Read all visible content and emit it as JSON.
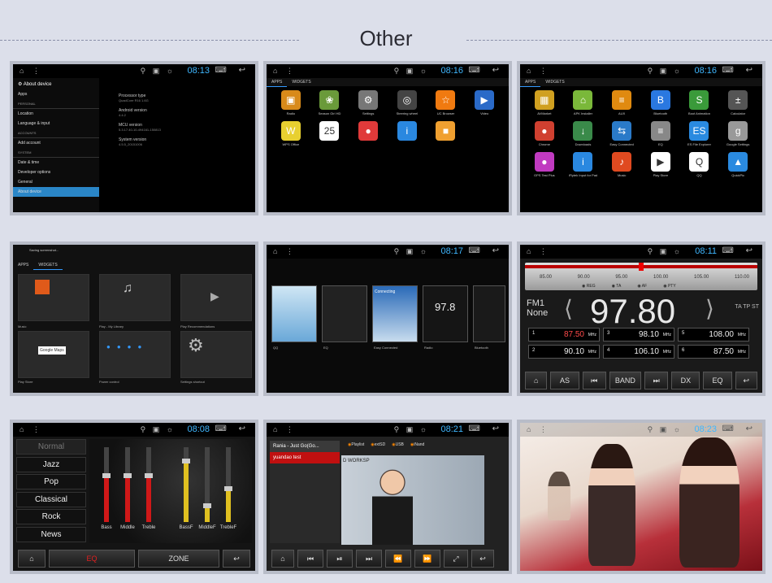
{
  "header": {
    "title": "Other"
  },
  "status": {
    "t1": "08:13",
    "t2": "08:16",
    "t3": "08:16",
    "t5": "08:17",
    "t6": "08:11",
    "t7": "08:08",
    "t8": "08:21",
    "t9": "08:23"
  },
  "settings": {
    "header": "About device",
    "items": [
      "Apps",
      "PERSONAL",
      "Location",
      "Language & input",
      "ACCOUNTS",
      "Add account",
      "SYSTEM",
      "Date & time",
      "Developer options",
      "General",
      "About device"
    ],
    "details": [
      {
        "label": "Processor type",
        "value": "QuadCore R16 1.6G"
      },
      {
        "label": "Android version",
        "value": "4.4.2"
      },
      {
        "label": "MCU version",
        "value": "5.3.17.40-10-494161-150813"
      },
      {
        "label": "System version",
        "value": "4.5.5_20151006"
      }
    ]
  },
  "apps1": {
    "tabs": [
      "APPS",
      "WIDGETS"
    ],
    "apps": [
      {
        "name": "Radio",
        "color": "#d88a1a",
        "glyph": "▣"
      },
      {
        "name": "Season Girl HD",
        "color": "#6a9a3a",
        "glyph": "❀"
      },
      {
        "name": "Settings",
        "color": "#777777",
        "glyph": "⚙"
      },
      {
        "name": "Steering wheel",
        "color": "#444444",
        "glyph": "◎"
      },
      {
        "name": "UC Browser",
        "color": "#f07a10",
        "glyph": "☆"
      },
      {
        "name": "Video",
        "color": "#2a6ac8",
        "glyph": "▶"
      },
      {
        "name": "WPS Office",
        "color": "#e8d030",
        "glyph": "W"
      },
      {
        "name": "",
        "color": "#ffffff",
        "glyph": "25"
      },
      {
        "name": "",
        "color": "#e03a3a",
        "glyph": "●"
      },
      {
        "name": "",
        "color": "#2a88e0",
        "glyph": "i"
      },
      {
        "name": "",
        "color": "#f0a030",
        "glyph": "■"
      }
    ]
  },
  "apps2": {
    "tabs": [
      "APPS",
      "WIDGETS"
    ],
    "apps": [
      {
        "name": "AVMarket",
        "color": "#d0a020",
        "glyph": "▦"
      },
      {
        "name": "APK Installer",
        "color": "#7ab83a",
        "glyph": "⌂"
      },
      {
        "name": "AUX",
        "color": "#e08a10",
        "glyph": "≡"
      },
      {
        "name": "Bluetooth",
        "color": "#2a78e0",
        "glyph": "B"
      },
      {
        "name": "Boot Animation",
        "color": "#3a9a3a",
        "glyph": "S"
      },
      {
        "name": "Calculator",
        "color": "#555555",
        "glyph": "±"
      },
      {
        "name": "Chrome",
        "color": "#d04030",
        "glyph": "●"
      },
      {
        "name": "Downloads",
        "color": "#3a8a4a",
        "glyph": "↓"
      },
      {
        "name": "Easy Connected",
        "color": "#2a7ac8",
        "glyph": "⇆"
      },
      {
        "name": "EQ",
        "color": "#888888",
        "glyph": "≡"
      },
      {
        "name": "ES File Explorer",
        "color": "#2a8ae0",
        "glyph": "ES"
      },
      {
        "name": "Google Settings",
        "color": "#999999",
        "glyph": "g"
      },
      {
        "name": "GPS Test Plus",
        "color": "#c03ac0",
        "glyph": "●"
      },
      {
        "name": "iFlytek Input for Pad",
        "color": "#2a88e0",
        "glyph": "i"
      },
      {
        "name": "Music",
        "color": "#e04a20",
        "glyph": "♪"
      },
      {
        "name": "Play Store",
        "color": "#ffffff",
        "glyph": "▶"
      },
      {
        "name": "QQ",
        "color": "#ffffff",
        "glyph": "Q"
      },
      {
        "name": "QuickPic",
        "color": "#2a8ae0",
        "glyph": "▲"
      }
    ]
  },
  "widgets": {
    "notice": "Saving screenshot...",
    "tabs": [
      "APPS",
      "WIDGETS"
    ],
    "labels": [
      "Music",
      "Play - My Library",
      "Play Recommendations",
      "Play Store",
      "Power control",
      "Settings shortcut"
    ],
    "maps": "Google Maps"
  },
  "recents": {
    "labels": [
      "QQ",
      "EQ",
      "Easy Connected",
      "Radio",
      "Bluetooth"
    ],
    "freq": "97.8",
    "connect": "Connecting"
  },
  "radio": {
    "ticks": [
      "85.00",
      "90.00",
      "95.00",
      "100.00",
      "105.00",
      "110.00"
    ],
    "options": [
      "REG",
      "TA",
      "AF",
      "PTY"
    ],
    "band": "FM1",
    "ps": "None",
    "freq": "97.80",
    "flags": "TA  TP  ST",
    "unit": "MHz",
    "presets": [
      {
        "n": "1",
        "v": "87.50"
      },
      {
        "n": "3",
        "v": "98.10"
      },
      {
        "n": "5",
        "v": "108.00"
      },
      {
        "n": "2",
        "v": "90.10"
      },
      {
        "n": "4",
        "v": "106.10"
      },
      {
        "n": "6",
        "v": "87.50"
      }
    ],
    "buttons": [
      "AS",
      "BAND",
      "DX",
      "EQ"
    ]
  },
  "eq": {
    "presets": [
      "Normal",
      "Jazz",
      "Pop",
      "Classical",
      "Rock",
      "News"
    ],
    "bands": [
      {
        "label": "Bass",
        "level": 0.62,
        "color": "#d01818"
      },
      {
        "label": "Middle",
        "level": 0.62,
        "color": "#d01818"
      },
      {
        "label": "Treble",
        "level": 0.62,
        "color": "#d01818"
      },
      {
        "label": "BassF",
        "level": 0.82,
        "color": "#e0c020"
      },
      {
        "label": "MiddleF",
        "level": 0.22,
        "color": "#e0c020"
      },
      {
        "label": "TrebleF",
        "level": 0.45,
        "color": "#e0c020"
      }
    ],
    "bottom": [
      "EQ",
      "ZONE"
    ]
  },
  "video": {
    "title": "Rania - Just Go(Go...",
    "selected": "yuandao test",
    "tabs": [
      "Playlist",
      "extSD",
      "USB",
      "iNand"
    ],
    "overlay": "D WORKSP"
  },
  "photo": {
    "watermark": ""
  }
}
